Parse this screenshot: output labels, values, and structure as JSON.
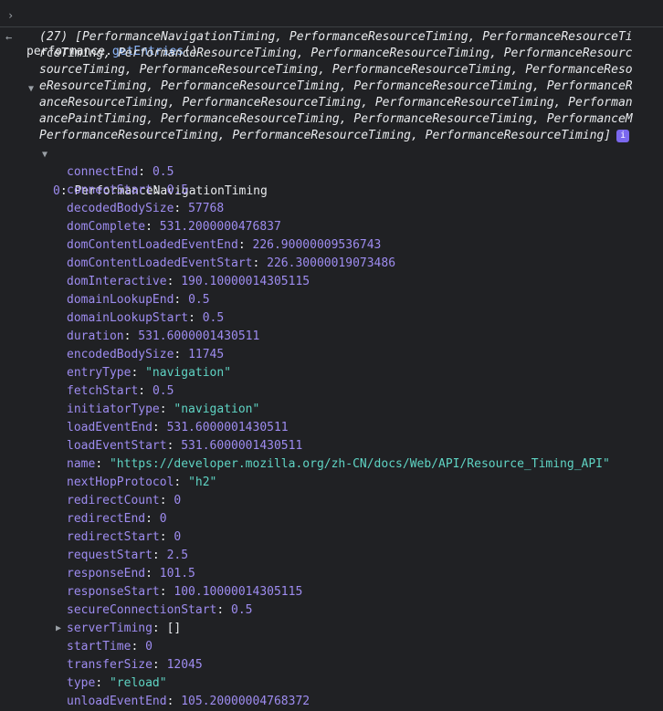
{
  "command": {
    "object": "performance.",
    "method": "getEntries",
    "suffix": "()"
  },
  "summary": {
    "lines": [
      "(27) [PerformanceNavigationTiming, PerformanceResourceTiming, PerformanceResourceTi",
      "rceTiming, PerformanceResourceTiming, PerformanceResourceTiming, PerformanceResourc",
      "sourceTiming, PerformanceResourceTiming, PerformanceResourceTiming, PerformanceReso",
      "eResourceTiming, PerformanceResourceTiming, PerformanceResourceTiming, PerformanceR",
      "anceResourceTiming, PerformanceResourceTiming, PerformanceResourceTiming, Performan",
      "ancePaintTiming, PerformanceResourceTiming, PerformanceResourceTiming, PerformanceM",
      "PerformanceResourceTiming, PerformanceResourceTiming, PerformanceResourceTiming]"
    ],
    "info": "i"
  },
  "entry": {
    "index": "0",
    "type": "PerformanceNavigationTiming"
  },
  "properties": [
    {
      "key": "connectEnd",
      "value": "0.5",
      "kind": "num"
    },
    {
      "key": "connectStart",
      "value": "0.5",
      "kind": "num"
    },
    {
      "key": "decodedBodySize",
      "value": "57768",
      "kind": "num"
    },
    {
      "key": "domComplete",
      "value": "531.2000000476837",
      "kind": "num"
    },
    {
      "key": "domContentLoadedEventEnd",
      "value": "226.90000009536743",
      "kind": "num"
    },
    {
      "key": "domContentLoadedEventStart",
      "value": "226.30000019073486",
      "kind": "num"
    },
    {
      "key": "domInteractive",
      "value": "190.10000014305115",
      "kind": "num"
    },
    {
      "key": "domainLookupEnd",
      "value": "0.5",
      "kind": "num"
    },
    {
      "key": "domainLookupStart",
      "value": "0.5",
      "kind": "num"
    },
    {
      "key": "duration",
      "value": "531.6000001430511",
      "kind": "num"
    },
    {
      "key": "encodedBodySize",
      "value": "11745",
      "kind": "num"
    },
    {
      "key": "entryType",
      "value": "\"navigation\"",
      "kind": "str"
    },
    {
      "key": "fetchStart",
      "value": "0.5",
      "kind": "num"
    },
    {
      "key": "initiatorType",
      "value": "\"navigation\"",
      "kind": "str"
    },
    {
      "key": "loadEventEnd",
      "value": "531.6000001430511",
      "kind": "num"
    },
    {
      "key": "loadEventStart",
      "value": "531.6000001430511",
      "kind": "num"
    },
    {
      "key": "name",
      "value": "\"https://developer.mozilla.org/zh-CN/docs/Web/API/Resource_Timing_API\"",
      "kind": "str"
    },
    {
      "key": "nextHopProtocol",
      "value": "\"h2\"",
      "kind": "str"
    },
    {
      "key": "redirectCount",
      "value": "0",
      "kind": "num"
    },
    {
      "key": "redirectEnd",
      "value": "0",
      "kind": "num"
    },
    {
      "key": "redirectStart",
      "value": "0",
      "kind": "num"
    },
    {
      "key": "requestStart",
      "value": "2.5",
      "kind": "num"
    },
    {
      "key": "responseEnd",
      "value": "101.5",
      "kind": "num"
    },
    {
      "key": "responseStart",
      "value": "100.10000014305115",
      "kind": "num"
    },
    {
      "key": "secureConnectionStart",
      "value": "0.5",
      "kind": "num"
    },
    {
      "key": "serverTiming",
      "value": "[]",
      "kind": "punct",
      "expandable": true
    },
    {
      "key": "startTime",
      "value": "0",
      "kind": "num"
    },
    {
      "key": "transferSize",
      "value": "12045",
      "kind": "num"
    },
    {
      "key": "type",
      "value": "\"reload\"",
      "kind": "str"
    },
    {
      "key": "unloadEventEnd",
      "value": "105.20000004768372",
      "kind": "num"
    }
  ],
  "colors": {
    "background": "#202124",
    "key": "#9e8cf0",
    "string": "#5fd4c4",
    "method": "#8ab4f8"
  }
}
